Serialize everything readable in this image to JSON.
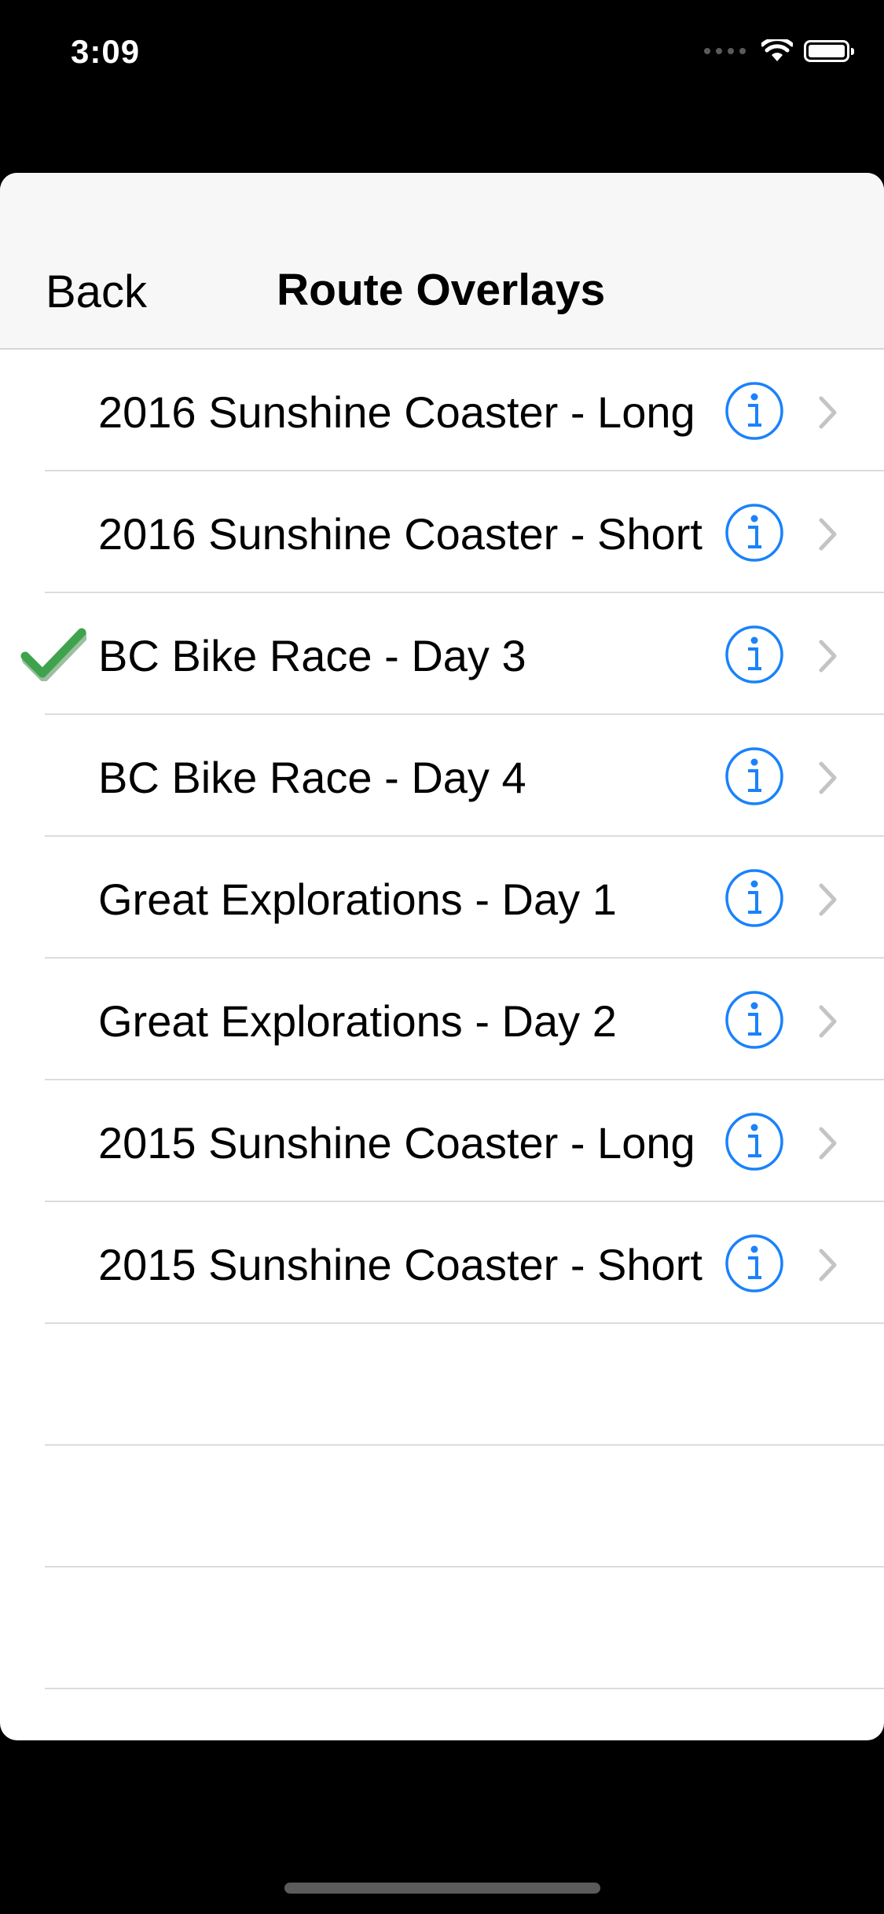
{
  "status_bar": {
    "time": "3:09"
  },
  "nav": {
    "back_label": "Back",
    "title": "Route Overlays"
  },
  "routes": [
    {
      "label": "2016 Sunshine Coaster - Long",
      "selected": false
    },
    {
      "label": "2016 Sunshine Coaster - Short",
      "selected": false
    },
    {
      "label": "BC Bike Race - Day 3",
      "selected": true
    },
    {
      "label": "BC Bike Race - Day 4",
      "selected": false
    },
    {
      "label": "Great Explorations - Day 1",
      "selected": false
    },
    {
      "label": "Great Explorations - Day 2",
      "selected": false
    },
    {
      "label": "2015 Sunshine Coaster - Long",
      "selected": false
    },
    {
      "label": "2015 Sunshine Coaster - Short",
      "selected": false
    }
  ],
  "icons": {
    "selected": "checkmark-icon",
    "info": "info-icon",
    "disclosure": "chevron-right-icon"
  },
  "colors": {
    "accent": "#1a82fb",
    "check": "#3fa34d",
    "chevron": "#c4c4c7"
  }
}
